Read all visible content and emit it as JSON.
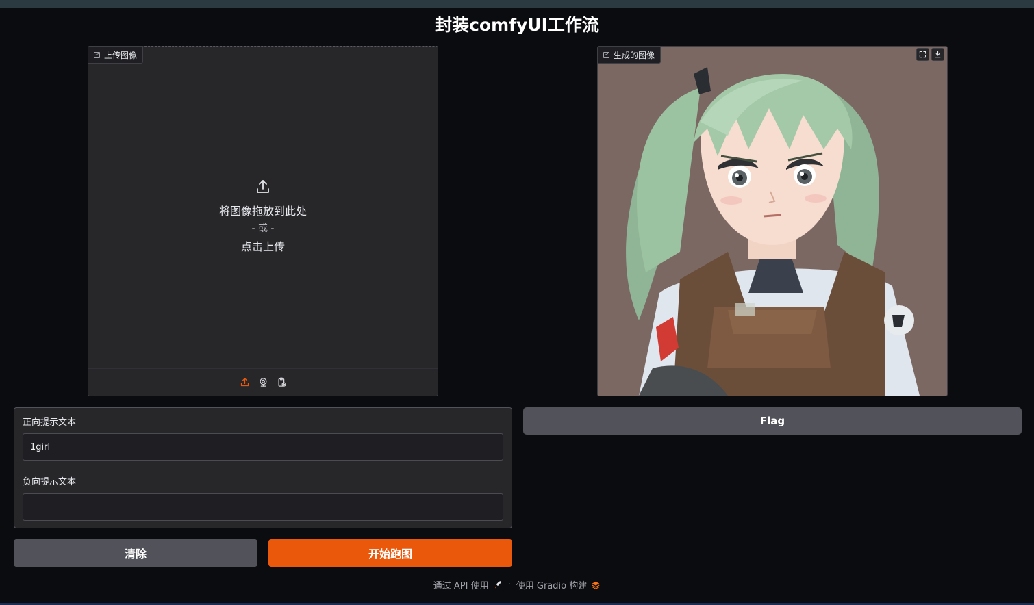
{
  "app": {
    "title": "封装comfyUI工作流"
  },
  "upload": {
    "label": "上传图像",
    "drop_text": "将图像拖放到此处",
    "or_text": "- 或 -",
    "click_text": "点击上传",
    "sources": [
      "upload-icon",
      "webcam-icon",
      "clipboard-icon"
    ],
    "accent_color": "#ea580c"
  },
  "output": {
    "label": "生成的图像",
    "actions": [
      "fullscreen-icon",
      "download-icon"
    ]
  },
  "prompts": {
    "positive_label": "正向提示文本",
    "positive_value": "1girl",
    "negative_label": "负向提示文本",
    "negative_value": ""
  },
  "buttons": {
    "flag": "Flag",
    "clear": "清除",
    "run": "开始跑图"
  },
  "footer": {
    "api_text": "通过 API 使用",
    "separator": "·",
    "built_with": "使用 Gradio 构建"
  },
  "colors": {
    "background": "#0b0c0f",
    "panel": "#27272a",
    "secondary_button": "#52525b",
    "primary_button": "#ea580c"
  }
}
